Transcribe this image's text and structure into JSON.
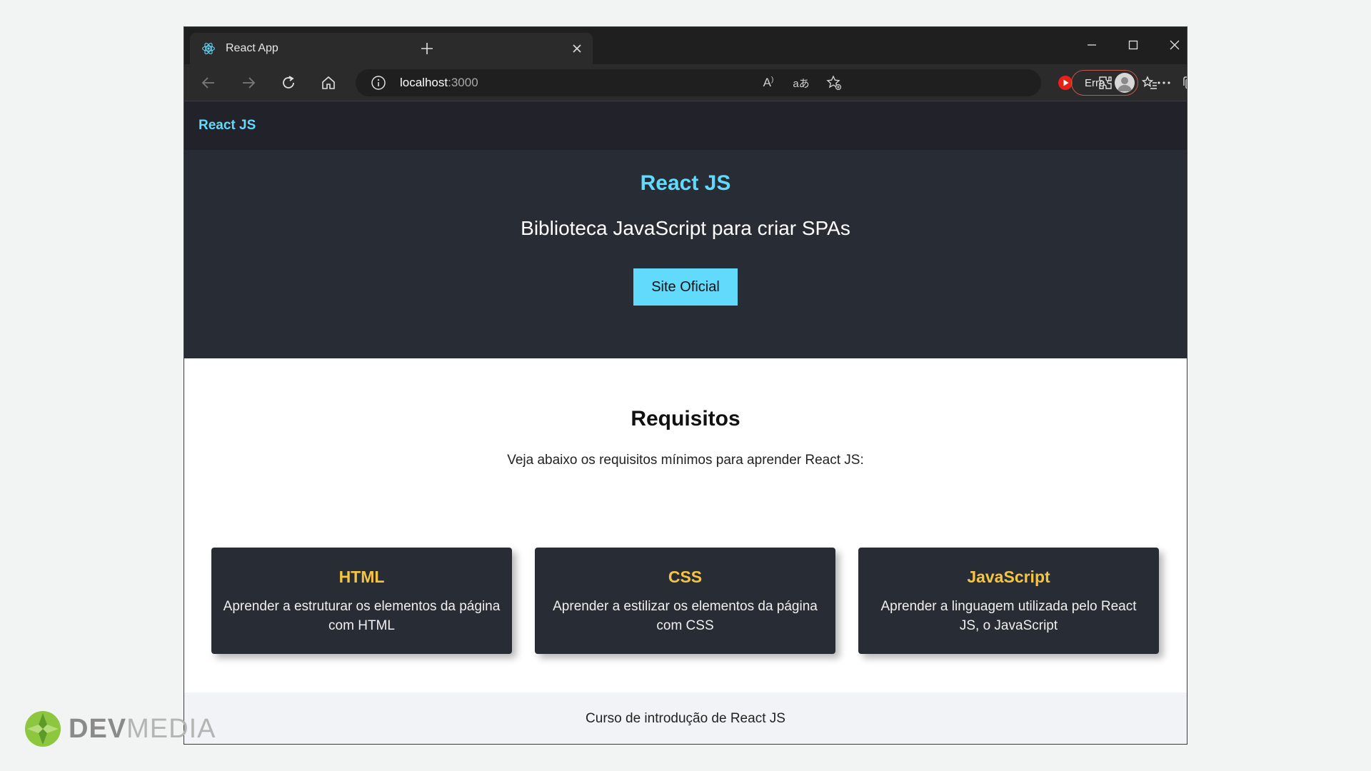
{
  "browser": {
    "tab_title": "React App",
    "url_host": "localhost",
    "url_port": ":3000",
    "profile_label": "Erro"
  },
  "navbar": {
    "brand": "React JS"
  },
  "hero": {
    "title": "React JS",
    "subtitle": "Biblioteca JavaScript para criar SPAs",
    "button_label": "Site Oficial"
  },
  "requisitos": {
    "title": "Requisitos",
    "description": "Veja abaixo os requisitos mínimos para aprender React JS:",
    "cards": [
      {
        "title": "HTML",
        "text": "Aprender a estruturar os elementos da página com HTML"
      },
      {
        "title": "CSS",
        "text": "Aprender a estilizar os elementos da página com CSS"
      },
      {
        "title": "JavaScript",
        "text": "Aprender a linguagem utilizada pelo React JS, o JavaScript"
      }
    ]
  },
  "footer": {
    "text": "Curso de introdução de React JS"
  },
  "watermark": {
    "part1": "DEV",
    "part2": "MEDIA"
  },
  "colors": {
    "react_blue": "#61dafb",
    "hero_bg": "#282c34",
    "navbar_bg": "#21222a",
    "card_title": "#f5c542"
  },
  "icons": [
    "react-favicon-icon",
    "close-icon",
    "plus-icon",
    "minimize-icon",
    "maximize-icon",
    "back-icon",
    "forward-icon",
    "refresh-icon",
    "home-icon",
    "info-icon",
    "read-aloud-icon",
    "translate-icon",
    "add-favorite-icon",
    "youtube-extension-icon",
    "extensions-icon",
    "favorites-icon",
    "collections-icon",
    "download-icon",
    "more-icon"
  ]
}
